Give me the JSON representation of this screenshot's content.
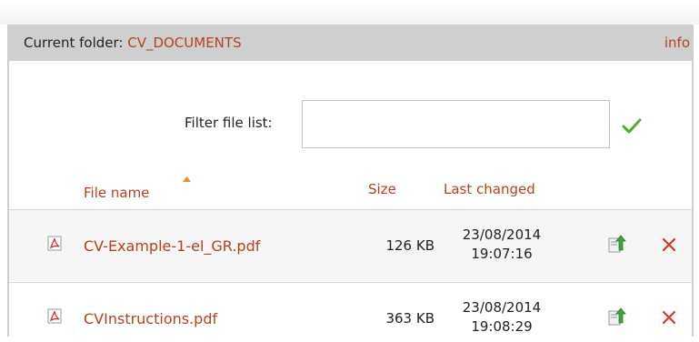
{
  "header": {
    "current_folder_label": "Current folder: ",
    "folder_name": "CV_DOCUMENTS",
    "info_link": "info"
  },
  "filter": {
    "label": "Filter file list:",
    "value": "",
    "placeholder": ""
  },
  "columns": {
    "name": "File name",
    "size": "Size",
    "last_changed": "Last changed",
    "sort": "File name ascending"
  },
  "files": [
    {
      "name": "CV-Example-1-el_GR.pdf",
      "size": "126 KB",
      "date": "23/08/2014",
      "time": "19:07:16",
      "icon": "pdf-icon"
    },
    {
      "name": "CVInstructions.pdf",
      "size": "363 KB",
      "date": "23/08/2014",
      "time": "19:08:29",
      "icon": "pdf-icon"
    }
  ],
  "colors": {
    "accent": "#b5421e",
    "panel": "#cfcfcf",
    "row_alt": "#f6f6f6",
    "check": "#4caf2a",
    "delete": "#d8342c"
  }
}
